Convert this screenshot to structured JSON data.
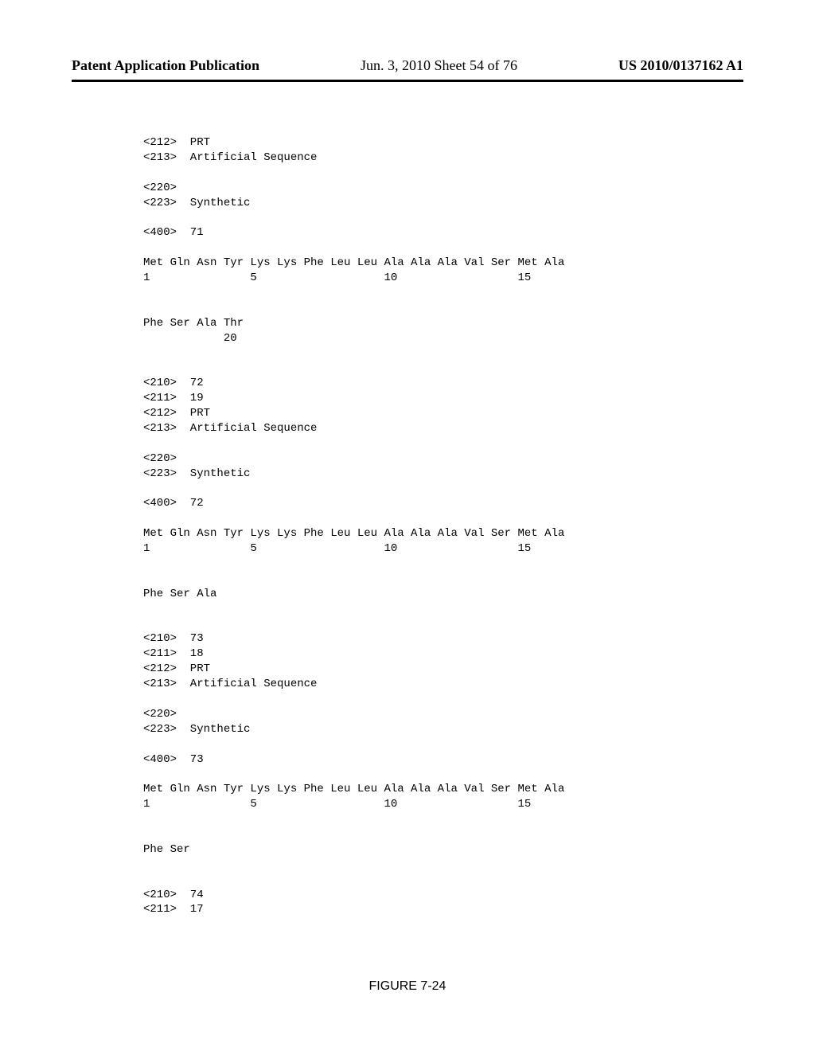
{
  "header": {
    "publication": "Patent Application Publication",
    "date_sheet": "Jun. 3, 2010  Sheet 54 of 76",
    "pub_number": "US 2010/0137162 A1"
  },
  "figure_label": "FIGURE 7-24",
  "listing": "<212>  PRT\n<213>  Artificial Sequence\n\n<220>\n<223>  Synthetic\n\n<400>  71\n\nMet Gln Asn Tyr Lys Lys Phe Leu Leu Ala Ala Ala Val Ser Met Ala\n1               5                   10                  15\n\n\nPhe Ser Ala Thr\n            20\n\n\n<210>  72\n<211>  19\n<212>  PRT\n<213>  Artificial Sequence\n\n<220>\n<223>  Synthetic\n\n<400>  72\n\nMet Gln Asn Tyr Lys Lys Phe Leu Leu Ala Ala Ala Val Ser Met Ala\n1               5                   10                  15\n\n\nPhe Ser Ala\n\n\n<210>  73\n<211>  18\n<212>  PRT\n<213>  Artificial Sequence\n\n<220>\n<223>  Synthetic\n\n<400>  73\n\nMet Gln Asn Tyr Lys Lys Phe Leu Leu Ala Ala Ala Val Ser Met Ala\n1               5                   10                  15\n\n\nPhe Ser\n\n\n<210>  74\n<211>  17"
}
